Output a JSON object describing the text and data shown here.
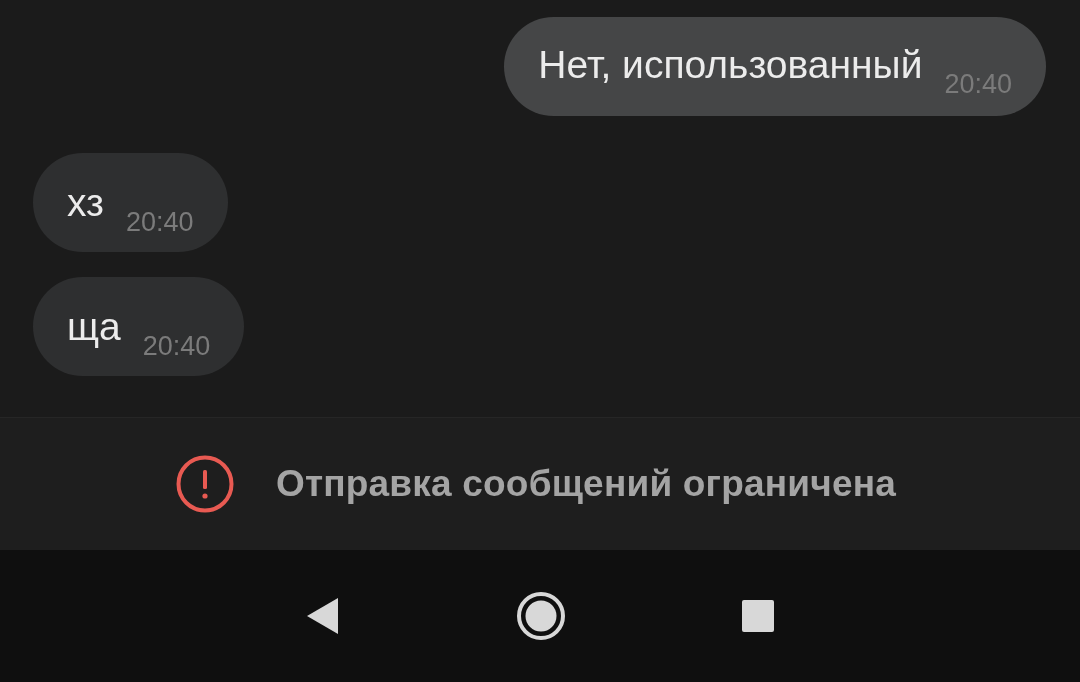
{
  "messages": [
    {
      "kind": "outgoing",
      "text": "Нет, использованный",
      "time": "20:40"
    },
    {
      "kind": "incoming",
      "text": "хз",
      "time": "20:40"
    },
    {
      "kind": "incoming",
      "text": "ща",
      "time": "20:40"
    }
  ],
  "notice": {
    "text": "Отправка сообщений ограничена"
  }
}
